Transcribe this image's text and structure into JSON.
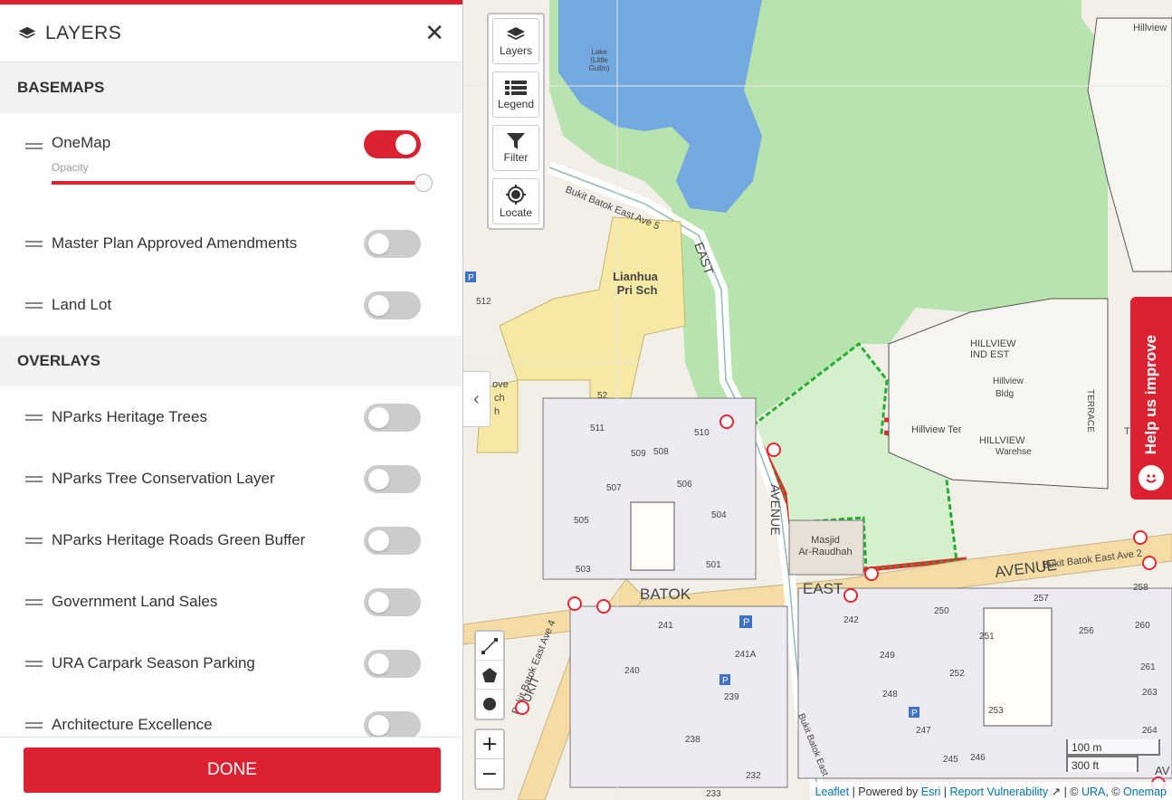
{
  "panel": {
    "title": "LAYERS",
    "close_label": "✕",
    "done_label": "DONE",
    "basemaps_heading": "BASEMAPS",
    "overlays_heading": "OVERLAYS",
    "opacity_label": "Opacity",
    "onemap": {
      "label": "OneMap",
      "enabled": true,
      "opacity": 1.0
    },
    "basemaps": [
      {
        "label": "Master Plan Approved Amendments",
        "enabled": false
      },
      {
        "label": "Land Lot",
        "enabled": false
      }
    ],
    "overlays": [
      {
        "label": "NParks Heritage Trees",
        "enabled": false
      },
      {
        "label": "NParks Tree Conservation Layer",
        "enabled": false
      },
      {
        "label": "NParks Heritage Roads Green Buffer",
        "enabled": false
      },
      {
        "label": "Government Land Sales",
        "enabled": false
      },
      {
        "label": "URA Carpark Season Parking",
        "enabled": false
      },
      {
        "label": "Architecture Excellence",
        "enabled": false
      }
    ],
    "accent_color": "#dc2231"
  },
  "map": {
    "controls": [
      {
        "label": "Layers",
        "icon": "layers-icon"
      },
      {
        "label": "Legend",
        "icon": "legend-icon"
      },
      {
        "label": "Filter",
        "icon": "filter-icon"
      },
      {
        "label": "Locate",
        "icon": "locate-icon"
      }
    ],
    "draw_tools": [
      "polyline-icon",
      "polygon-icon",
      "circle-icon"
    ],
    "zoom_in": "+",
    "zoom_out": "−",
    "scale_metric": "100 m",
    "scale_imperial": "300 ft",
    "help_tab_label": "Help us improve",
    "attribution": {
      "leaflet": "Leaflet",
      "sep1": " | Powered by ",
      "esri": "Esri",
      "sep2": " | ",
      "report": "Report Vulnerability",
      "sep3": " | © ",
      "ura": "URA",
      "sep4": ", © ",
      "onemap": "Onemap"
    },
    "labels": {
      "lake": "Lake",
      "lake2": "(Little",
      "lake3": "Guilin)",
      "school1": "Lianhua",
      "school2": "Pri Sch",
      "mosque1": "Masjid",
      "mosque2": "Ar-Raudhah",
      "ave5": "Bukit Batok East Ave 5",
      "east": "EAST",
      "batok": "BATOK",
      "east2": "EAST",
      "avenue": "AVENUE",
      "avenue_v": "AVENUE",
      "ave2": "Bukit Batok East Ave 2",
      "ave4": "Bukit Batok East Ave 4",
      "hillview_ter": "Hillview Ter",
      "hillview": "HILLVIEW",
      "hillview_ind": "HILLVIEW",
      "ind_est": "IND EST",
      "hillview_bldg": "Hillview",
      "bldg": "Bldg",
      "warehse": "Warehse",
      "terrace": "TERRACE",
      "hillview_top": "Hillview",
      "ove": "ove",
      "ch": "ch",
      "h": "h",
      "bukit_st": "Bukit Batok East",
      "b511": "511",
      "b509": "509",
      "b508": "508",
      "b510": "510",
      "b507": "507",
      "b506": "506",
      "b505": "505",
      "b504": "504",
      "b503": "503",
      "b501": "501",
      "b512": "512",
      "b52": "52",
      "b241": "241",
      "b241a": "241A",
      "b240": "240",
      "b239": "239",
      "b238": "238",
      "b242": "242",
      "b249": "249",
      "b250": "250",
      "b251": "251",
      "b252": "252",
      "b257": "257",
      "b258": "258",
      "b256": "256",
      "b260": "260",
      "b261": "261",
      "b248": "248",
      "b247": "247",
      "b253": "253",
      "b263": "263",
      "b264": "264",
      "b246": "246",
      "b245": "245",
      "b232": "232",
      "b233": "233",
      "bukit": "BUKIT",
      "p": "P",
      "ter": "TER",
      "av": "AV"
    }
  }
}
